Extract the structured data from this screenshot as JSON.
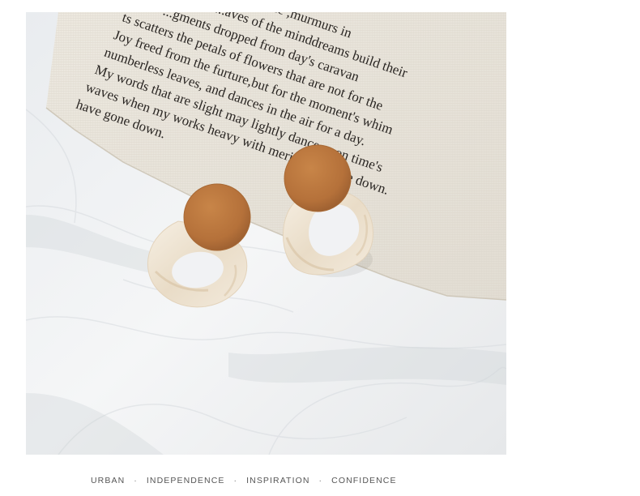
{
  "card_text": [
    "ts scatters the petals of flowers that are not for the",
    "Joy freed from the furture,but for the moment's whim",
    "numberless leaves, and dances in the air for a day.",
    "My words that are slight may lightly dance upon time's",
    "waves when my works heavy with merit have gone down.",
    "have gone down."
  ],
  "card_text_top": [
    "...gments dropped from day's caravan",
    "...aves of the minddreams build their",
    "ance ,murmurs in"
  ],
  "tagline": {
    "items": [
      "URBAN",
      "INDEPENDENCE",
      "INSPIRATION",
      "CONFIDENCE"
    ],
    "separator": "·"
  },
  "colors": {
    "wood": "#b9753d",
    "marble": "#efe4d2",
    "canvas": "#ebe6dc",
    "paper": "#f1f2f4",
    "tagline_text": "#555555"
  }
}
